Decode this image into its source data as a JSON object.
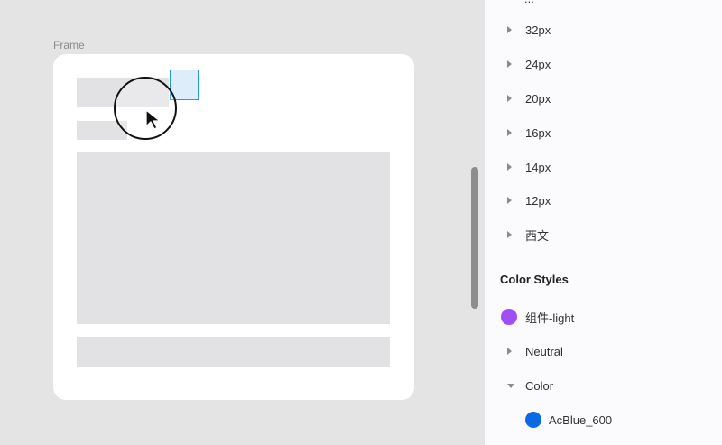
{
  "canvas": {
    "frame_label": "Frame"
  },
  "panel": {
    "top_cut_label": "...",
    "text_style_groups": [
      "32px",
      "24px",
      "20px",
      "16px",
      "14px",
      "12px",
      "西文"
    ],
    "section_title": "Color Styles",
    "color_items": [
      {
        "label": "组件-light",
        "swatch": "#a04ef6"
      },
      {
        "label": "Neutral"
      },
      {
        "label": "Color"
      },
      {
        "label": "AcBlue_600",
        "swatch": "#0a6ae6"
      }
    ]
  }
}
